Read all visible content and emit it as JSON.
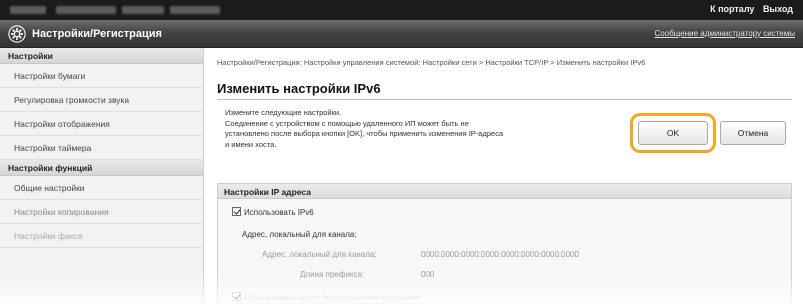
{
  "topbar": {
    "to_portal": "К порталу",
    "logout": "Выход"
  },
  "titlebar": {
    "title": "Настройки/Регистрация",
    "admin_message": "Сообщение администратору системы",
    "icon": "gear-icon"
  },
  "sidebar": {
    "section1_title": "Настройки",
    "section1_items": [
      "Настройки бумаги",
      "Регулировка громкости звука",
      "Настройки отображения",
      "Настройки таймера"
    ],
    "section2_title": "Настройки функций",
    "section2_items": [
      "Общие настройки",
      "Настройки копирования",
      "Настройки факса"
    ]
  },
  "main": {
    "breadcrumb": "Настройки/Регистрация: Настройки управления системой: Настройки сети > Настройки TCP/IP > Изменить настройки IPv6",
    "heading": "Изменить настройки IPv6",
    "description_line1": "Измените следующие настройки.",
    "description_line2": "Соединение с устройством с помощью удаленного ИП может быть не",
    "description_line3": "установлено после выбора кнопки [OK], чтобы применить изменения IP-адреса",
    "description_line4": "и имени хоста.",
    "ok_label": "OK",
    "cancel_label": "Отмена",
    "highlight_color": "#f5a623"
  },
  "ip_section": {
    "title": "Настройки IP адреса",
    "use_ipv6_label": "Использовать IPv6",
    "use_ipv6_checked": true,
    "link_local_heading": "Адрес, локальный для канала:",
    "link_local_label": "Адрес, локальный для канала:",
    "link_local_value": "0000:0000:0000:0000:0000:0000:0000:0000",
    "prefix_label": "Длина префикса:",
    "prefix_value": "000",
    "stateless_label": "Использовать адрес без сохранения состояния"
  }
}
